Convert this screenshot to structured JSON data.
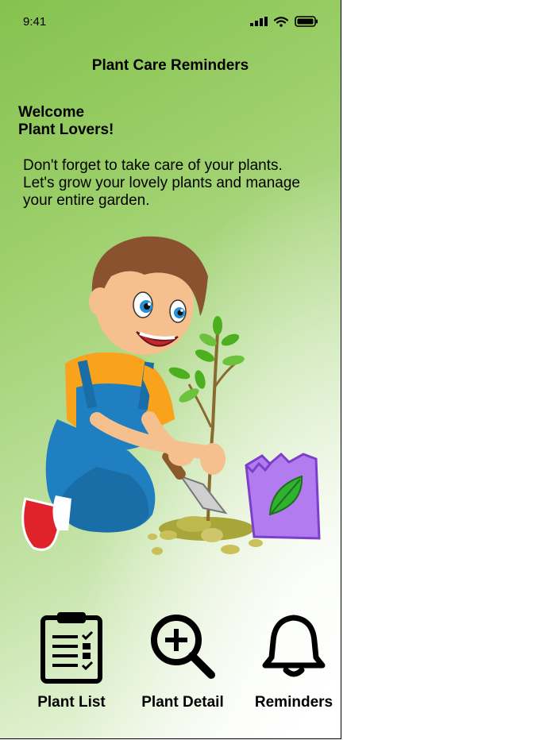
{
  "status_bar": {
    "time": "9:41"
  },
  "header": {
    "title": "Plant Care Reminders"
  },
  "welcome": {
    "line1": "Welcome",
    "line2": "Plant Lovers!"
  },
  "description": {
    "line1": "Don't forget to take care of your plants.",
    "line2": "Let's grow your lovely plants and manage",
    "line3": "your entire garden."
  },
  "nav": {
    "items": [
      {
        "label": "Plant List",
        "icon": "clipboard-list-icon"
      },
      {
        "label": "Plant Detail",
        "icon": "zoom-in-icon"
      },
      {
        "label": "Reminders",
        "icon": "bell-icon"
      }
    ]
  },
  "colors": {
    "background_start": "#84c24e",
    "background_end": "#ffffff",
    "text": "#000000"
  }
}
